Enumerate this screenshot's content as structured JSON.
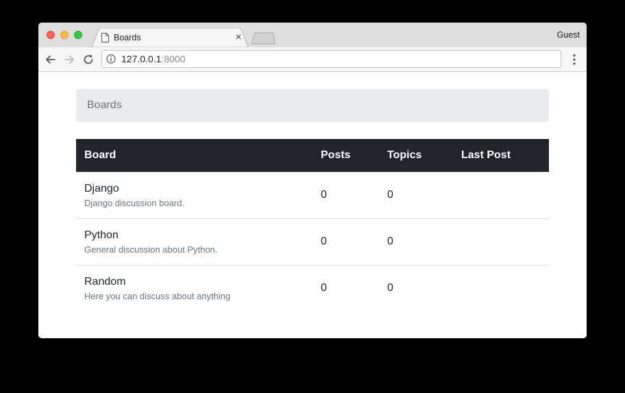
{
  "browser": {
    "tab_title": "Boards",
    "profile": "Guest",
    "url_host": "127.0.0.1",
    "url_port": ":8000"
  },
  "breadcrumb": {
    "label": "Boards"
  },
  "table": {
    "headers": {
      "board": "Board",
      "posts": "Posts",
      "topics": "Topics",
      "last_post": "Last Post"
    },
    "rows": [
      {
        "name": "Django",
        "description": "Django discussion board.",
        "posts": "0",
        "topics": "0",
        "last_post": ""
      },
      {
        "name": "Python",
        "description": "General discussion about Python.",
        "posts": "0",
        "topics": "0",
        "last_post": ""
      },
      {
        "name": "Random",
        "description": "Here you can discuss about anything",
        "posts": "0",
        "topics": "0",
        "last_post": ""
      }
    ]
  },
  "colors": {
    "header_bg": "#212529",
    "breadcrumb_bg": "#e9ecef",
    "muted_text": "#6c757d"
  },
  "icons": [
    "page-icon",
    "close-icon",
    "back-arrow-icon",
    "forward-arrow-icon",
    "reload-icon",
    "info-icon",
    "kebab-menu-icon"
  ]
}
